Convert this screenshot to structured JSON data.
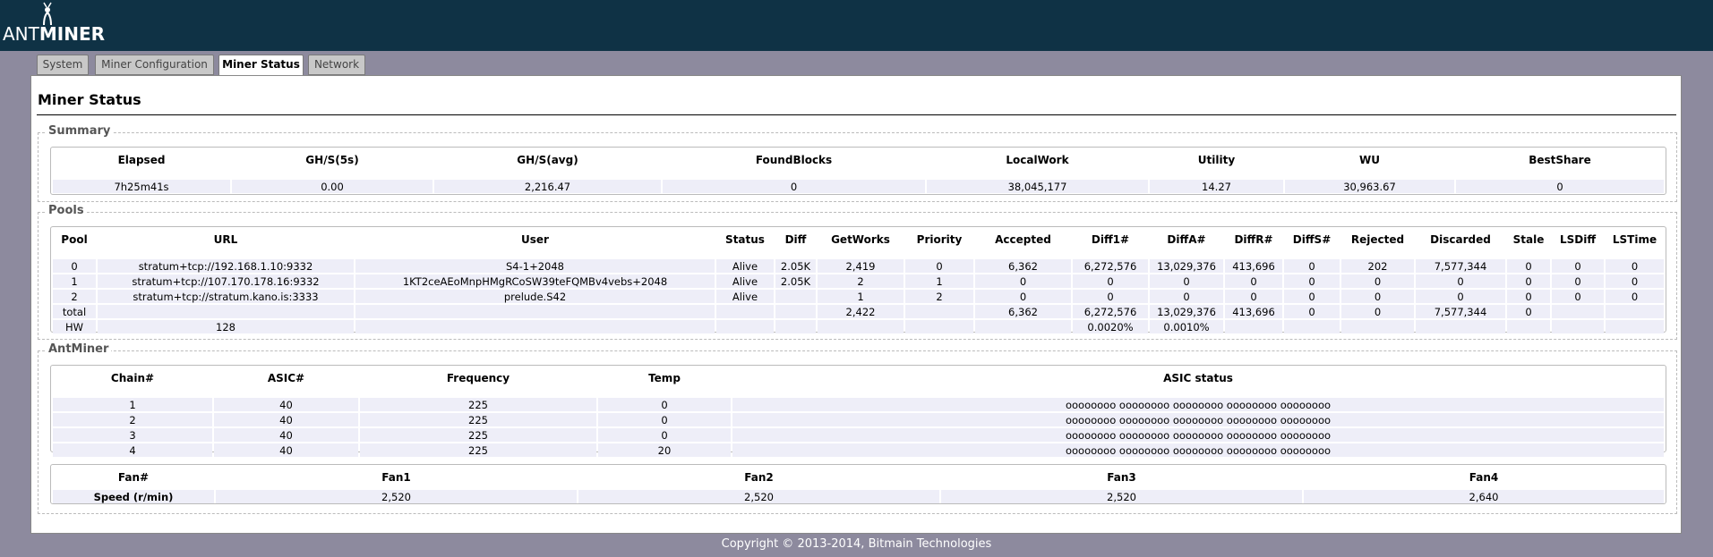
{
  "brand": {
    "light": "ANT",
    "bold": "MINER"
  },
  "tabs": [
    {
      "label": "System"
    },
    {
      "label": "Miner Configuration"
    },
    {
      "label": "Miner Status"
    },
    {
      "label": "Network"
    }
  ],
  "page_title": "Miner Status",
  "summary": {
    "legend": "Summary",
    "headers": [
      "Elapsed",
      "GH/S(5s)",
      "GH/S(avg)",
      "FoundBlocks",
      "LocalWork",
      "Utility",
      "WU",
      "BestShare"
    ],
    "values": [
      "7h25m41s",
      "0.00",
      "2,216.47",
      "0",
      "38,045,177",
      "14.27",
      "30,963.67",
      "0"
    ]
  },
  "pools": {
    "legend": "Pools",
    "headers": [
      "Pool",
      "URL",
      "User",
      "Status",
      "Diff",
      "GetWorks",
      "Priority",
      "Accepted",
      "Diff1#",
      "DiffA#",
      "DiffR#",
      "DiffS#",
      "Rejected",
      "Discarded",
      "Stale",
      "LSDiff",
      "LSTime"
    ],
    "rows": [
      [
        "0",
        "stratum+tcp://192.168.1.10:9332",
        "S4-1+2048",
        "Alive",
        "2.05K",
        "2,419",
        "0",
        "6,362",
        "6,272,576",
        "13,029,376",
        "413,696",
        "0",
        "202",
        "7,577,344",
        "0",
        "0",
        "0"
      ],
      [
        "1",
        "stratum+tcp://107.170.178.16:9332",
        "1KT2ceAEoMnpHMgRCoSW39teFQMBv4vebs+2048",
        "Alive",
        "2.05K",
        "2",
        "1",
        "0",
        "0",
        "0",
        "0",
        "0",
        "0",
        "0",
        "0",
        "0",
        "0"
      ],
      [
        "2",
        "stratum+tcp://stratum.kano.is:3333",
        "prelude.S42",
        "Alive",
        "",
        "1",
        "2",
        "0",
        "0",
        "0",
        "0",
        "0",
        "0",
        "0",
        "0",
        "0",
        "0"
      ],
      [
        "total",
        "",
        "",
        "",
        "",
        "2,422",
        "",
        "6,362",
        "6,272,576",
        "13,029,376",
        "413,696",
        "0",
        "0",
        "7,577,344",
        "0",
        "",
        ""
      ],
      [
        "HW",
        "128",
        "",
        "",
        "",
        "",
        "",
        "",
        "0.0020%",
        "0.0010%",
        "",
        "",
        "",
        "",
        "",
        "",
        ""
      ]
    ]
  },
  "antminer": {
    "legend": "AntMiner",
    "chain_headers": [
      "Chain#",
      "ASIC#",
      "Frequency",
      "Temp",
      "ASIC status"
    ],
    "chains": [
      [
        "1",
        "40",
        "225",
        "0",
        "oooooooo oooooooo oooooooo oooooooo oooooooo"
      ],
      [
        "2",
        "40",
        "225",
        "0",
        "oooooooo oooooooo oooooooo oooooooo oooooooo"
      ],
      [
        "3",
        "40",
        "225",
        "0",
        "oooooooo oooooooo oooooooo oooooooo oooooooo"
      ],
      [
        "4",
        "40",
        "225",
        "20",
        "oooooooo oooooooo oooooooo oooooooo oooooooo"
      ]
    ],
    "fan_headers": [
      "Fan#",
      "Fan1",
      "Fan2",
      "Fan3",
      "Fan4"
    ],
    "fan_row": [
      "Speed (r/min)",
      "2,520",
      "2,520",
      "2,520",
      "2,640"
    ]
  },
  "footer": "Copyright © 2013-2014, Bitmain Technologies",
  "colors": {
    "header_bg": "#0f3245",
    "page_bg": "#8d8a9e",
    "cell_bg": "#eeeef8"
  }
}
